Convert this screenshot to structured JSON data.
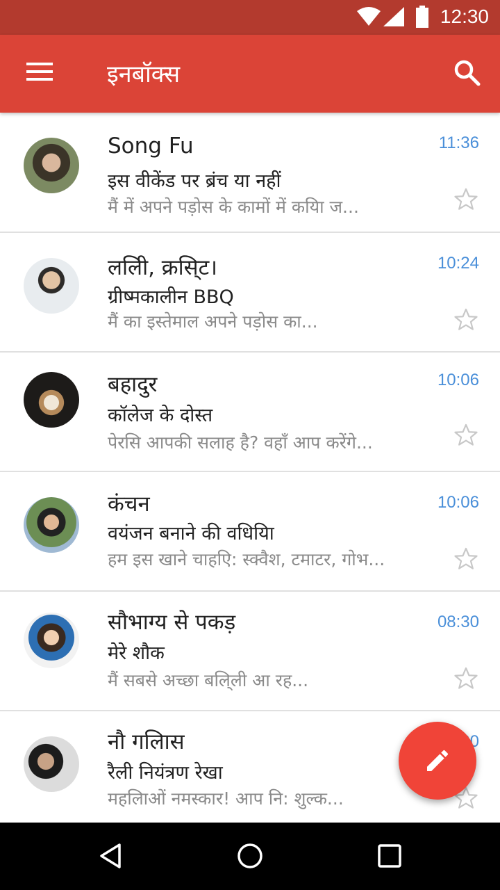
{
  "status_bar": {
    "time": "12:30"
  },
  "app_bar": {
    "title": "इनबॉक्स"
  },
  "emails": [
    {
      "sender": "Song Fu",
      "subject": "इस वीकेंड पर ब्रंच या नहीं",
      "snippet": "मैं में अपने पड़ोस के कामों में कयिा ज...",
      "time": "11:36",
      "starred": false
    },
    {
      "sender": "ललिी, क्रसि्ट।",
      "subject": "ग्रीष्मकालीन BBQ",
      "snippet": "मैं का इस्तेमाल अपने पड़ोस का...",
      "time": "10:24",
      "starred": false
    },
    {
      "sender": "बहादुर",
      "subject": "कॉलेज के दोस्त",
      "snippet": "पेरसि आपकी सलाह है? वहाँ आप करेंगे...",
      "time": "10:06",
      "starred": false
    },
    {
      "sender": "कंचन",
      "subject": "वयंजन बनाने की वधियिा",
      "snippet": "हम इस खाने चाहएि: स्क्वैश, टमाटर, गोभ...",
      "time": "10:06",
      "starred": false
    },
    {
      "sender": "सौभाग्य से पकड़",
      "subject": "मेरे शौक",
      "snippet": "मैं सबसे अच्छा बलि्ली आ रह...",
      "time": "08:30",
      "starred": false
    },
    {
      "sender": "नौ गलिास",
      "subject": "रैली नियंत्रण रेखा",
      "snippet": "महलिाओं नमस्कार! आप नि: शुल्क...",
      "time": "08:30",
      "starred": false
    }
  ],
  "icons": {
    "menu": "menu-icon",
    "search": "search-icon",
    "star": "star-outline-icon",
    "compose": "pencil-icon",
    "back": "back-icon",
    "home": "home-icon",
    "recents": "recents-icon"
  },
  "colors": {
    "status_bar": "#b33a2e",
    "app_bar": "#db4437",
    "fab": "#f04438",
    "time": "#4a8fd9"
  }
}
